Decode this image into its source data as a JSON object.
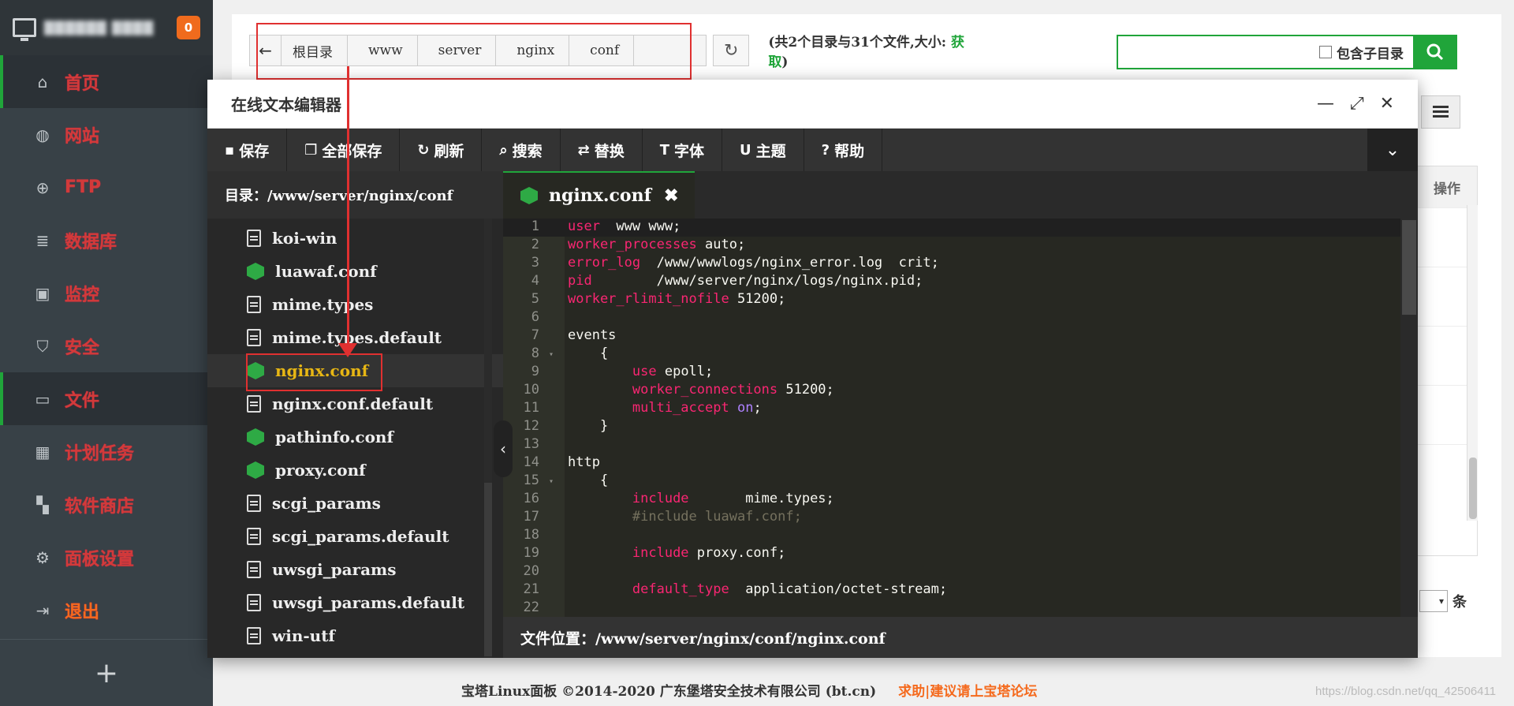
{
  "sidebar": {
    "host": "██████ ████",
    "badge": "0",
    "items": [
      {
        "label": "首页",
        "icon": "home-icon",
        "glyph": "⌂"
      },
      {
        "label": "网站",
        "icon": "globe-icon",
        "glyph": "◍"
      },
      {
        "label": "FTP",
        "icon": "ftp-icon",
        "glyph": "⊕"
      },
      {
        "label": "数据库",
        "icon": "database-icon",
        "glyph": "≣"
      },
      {
        "label": "监控",
        "icon": "monitor-icon",
        "glyph": "▣"
      },
      {
        "label": "安全",
        "icon": "shield-icon",
        "glyph": "⛉"
      },
      {
        "label": "文件",
        "icon": "folder-icon",
        "glyph": "▭"
      },
      {
        "label": "计划任务",
        "icon": "calendar-icon",
        "glyph": "▦"
      },
      {
        "label": "软件商店",
        "icon": "apps-icon",
        "glyph": "▚"
      },
      {
        "label": "面板设置",
        "icon": "gear-icon",
        "glyph": "⚙"
      },
      {
        "label": "退出",
        "icon": "logout-icon",
        "glyph": "⇥"
      }
    ],
    "add": "+"
  },
  "filebar": {
    "back_glyph": "←",
    "crumbs": [
      "根目录",
      "www",
      "server",
      "nginx",
      "conf"
    ],
    "refresh_glyph": "↻",
    "count_prefix": "(共2个目录与31个文件,大小: ",
    "count_link": "获取",
    "count_suffix": ")",
    "search_value": "",
    "subdir_label": "包含子目录"
  },
  "table": {
    "op_header": "操作"
  },
  "pager": {
    "unit": "条"
  },
  "footer": {
    "copyright": "宝塔Linux面板 ©2014-2020 广东堡塔安全技术有限公司 (bt.cn)",
    "forum_link": "求助|建议请上宝塔论坛",
    "watermark": "https://blog.csdn.net/qq_42506411"
  },
  "editor": {
    "title": "在线文本编辑器",
    "window_controls": {
      "min": "—",
      "max": "⤢",
      "close": "✕"
    },
    "toolbar": [
      {
        "label": "保存",
        "icon": "save-icon",
        "glyph": "▪"
      },
      {
        "label": "全部保存",
        "icon": "copy-icon",
        "glyph": "❐"
      },
      {
        "label": "刷新",
        "icon": "refresh-icon",
        "glyph": "↻"
      },
      {
        "label": "搜索",
        "icon": "search-icon",
        "glyph": "⌕"
      },
      {
        "label": "替换",
        "icon": "replace-icon",
        "glyph": "⇄"
      },
      {
        "label": "字体",
        "icon": "font-icon",
        "glyph": "T"
      },
      {
        "label": "主题",
        "icon": "theme-icon",
        "glyph": "U"
      },
      {
        "label": "帮助",
        "icon": "help-icon",
        "glyph": "?"
      }
    ],
    "collapse_glyph": "⌄",
    "directory": "目录：/www/server/nginx/conf",
    "files": [
      {
        "name": "koi-win",
        "type": "doc"
      },
      {
        "name": "luawaf.conf",
        "type": "ng"
      },
      {
        "name": "mime.types",
        "type": "doc"
      },
      {
        "name": "mime.types.default",
        "type": "doc"
      },
      {
        "name": "nginx.conf",
        "type": "ng",
        "active": true
      },
      {
        "name": "nginx.conf.default",
        "type": "doc"
      },
      {
        "name": "pathinfo.conf",
        "type": "ng"
      },
      {
        "name": "proxy.conf",
        "type": "ng"
      },
      {
        "name": "scgi_params",
        "type": "doc"
      },
      {
        "name": "scgi_params.default",
        "type": "doc"
      },
      {
        "name": "uwsgi_params",
        "type": "doc"
      },
      {
        "name": "uwsgi_params.default",
        "type": "doc"
      },
      {
        "name": "win-utf",
        "type": "doc"
      }
    ],
    "toggle_glyph": "‹",
    "tab": {
      "name": "nginx.conf",
      "close": "✖"
    },
    "code": [
      {
        "n": "1",
        "parts": [
          [
            "kw",
            "user"
          ],
          [
            "",
            "  www www;"
          ]
        ],
        "cur": true
      },
      {
        "n": "2",
        "parts": [
          [
            "kw",
            "worker_processes"
          ],
          [
            "",
            " auto;"
          ]
        ]
      },
      {
        "n": "3",
        "parts": [
          [
            "kw",
            "error_log"
          ],
          [
            "",
            "  /www/wwwlogs/nginx_error.log  crit;"
          ]
        ]
      },
      {
        "n": "4",
        "parts": [
          [
            "kw",
            "pid"
          ],
          [
            "",
            "        /www/server/nginx/logs/nginx.pid;"
          ]
        ]
      },
      {
        "n": "5",
        "parts": [
          [
            "kw",
            "worker_rlimit_nofile"
          ],
          [
            "",
            " 51200;"
          ]
        ]
      },
      {
        "n": "6",
        "parts": []
      },
      {
        "n": "7",
        "parts": [
          [
            "",
            "events"
          ]
        ]
      },
      {
        "n": "8",
        "fold": true,
        "parts": [
          [
            "",
            "    {"
          ]
        ]
      },
      {
        "n": "9",
        "parts": [
          [
            "",
            "        "
          ],
          [
            "kw",
            "use"
          ],
          [
            "",
            " epoll;"
          ]
        ]
      },
      {
        "n": "10",
        "parts": [
          [
            "",
            "        "
          ],
          [
            "kw",
            "worker_connections"
          ],
          [
            "",
            " 51200;"
          ]
        ]
      },
      {
        "n": "11",
        "parts": [
          [
            "",
            "        "
          ],
          [
            "kw",
            "multi_accept"
          ],
          [
            "",
            " "
          ],
          [
            "cn",
            "on"
          ],
          [
            "",
            ";"
          ]
        ]
      },
      {
        "n": "12",
        "parts": [
          [
            "",
            "    }"
          ]
        ]
      },
      {
        "n": "13",
        "parts": []
      },
      {
        "n": "14",
        "parts": [
          [
            "",
            "http"
          ]
        ]
      },
      {
        "n": "15",
        "fold": true,
        "parts": [
          [
            "",
            "    {"
          ]
        ]
      },
      {
        "n": "16",
        "parts": [
          [
            "",
            "        "
          ],
          [
            "kw",
            "include"
          ],
          [
            "",
            "       mime.types;"
          ]
        ]
      },
      {
        "n": "17",
        "parts": [
          [
            "",
            "        "
          ],
          [
            "cm",
            "#include luawaf.conf;"
          ]
        ]
      },
      {
        "n": "18",
        "parts": []
      },
      {
        "n": "19",
        "parts": [
          [
            "",
            "        "
          ],
          [
            "kw",
            "include"
          ],
          [
            "",
            " proxy.conf;"
          ]
        ]
      },
      {
        "n": "20",
        "parts": []
      },
      {
        "n": "21",
        "parts": [
          [
            "",
            "        "
          ],
          [
            "kw",
            "default_type"
          ],
          [
            "",
            "  application/octet-stream;"
          ]
        ]
      },
      {
        "n": "22",
        "parts": []
      }
    ],
    "status": "文件位置：/www/server/nginx/conf/nginx.conf"
  },
  "colors": {
    "accent_green": "#20a53a",
    "annotation_red": "#e03030",
    "keyword_pink": "#f92672",
    "nav_text_red": "#d23a3a",
    "active_file_yellow": "#e8b714"
  }
}
